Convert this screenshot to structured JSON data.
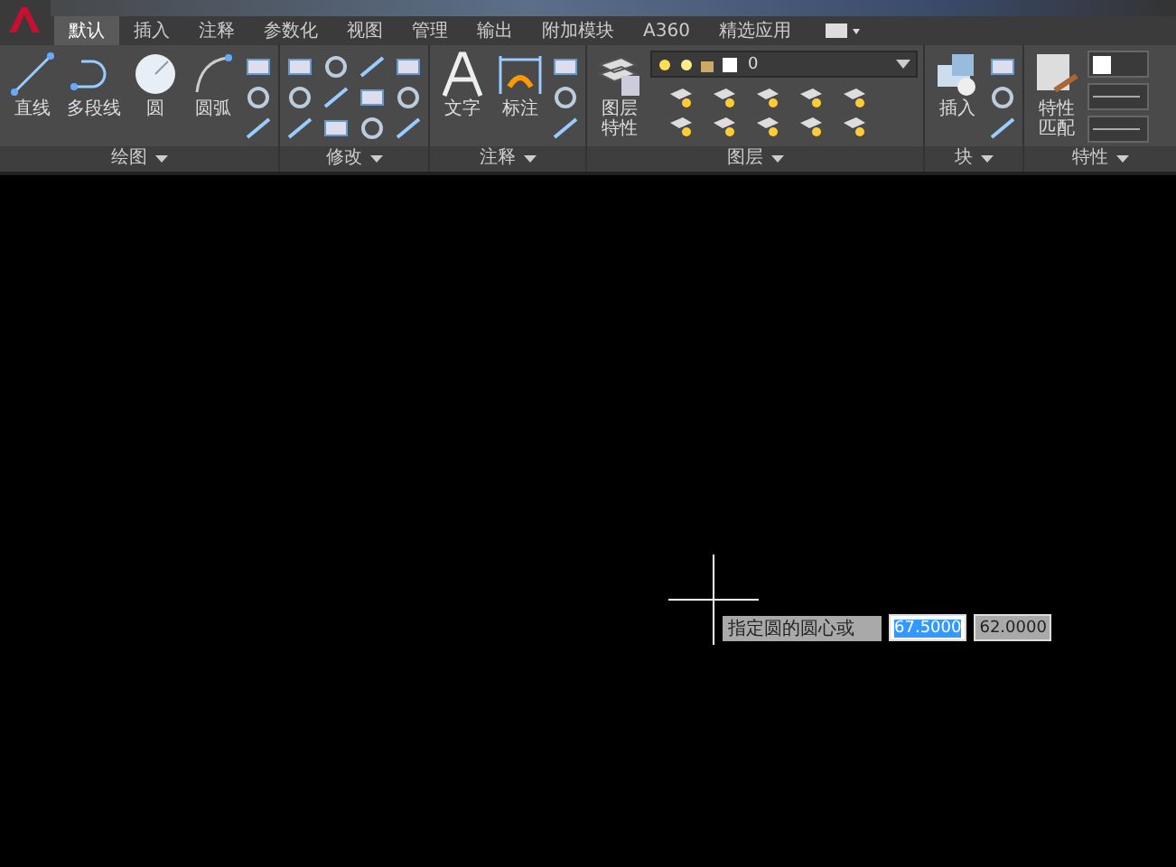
{
  "tabs": [
    {
      "label": "默认",
      "selected": true
    },
    {
      "label": "插入",
      "selected": false
    },
    {
      "label": "注释",
      "selected": false
    },
    {
      "label": "参数化",
      "selected": false
    },
    {
      "label": "视图",
      "selected": false
    },
    {
      "label": "管理",
      "selected": false
    },
    {
      "label": "输出",
      "selected": false
    },
    {
      "label": "附加模块",
      "selected": false
    },
    {
      "label": "A360",
      "selected": false
    },
    {
      "label": "精选应用",
      "selected": false
    }
  ],
  "panels": [
    {
      "title": "绘图",
      "tools": [
        {
          "label": "直线",
          "kind": "line"
        },
        {
          "label": "多段线",
          "kind": "polyline"
        },
        {
          "label": "圆",
          "kind": "circle"
        },
        {
          "label": "圆弧",
          "kind": "arc"
        }
      ]
    },
    {
      "title": "修改"
    },
    {
      "title": "注释",
      "tools": [
        {
          "label": "文字",
          "kind": "text"
        },
        {
          "label": "标注",
          "kind": "dimension"
        }
      ]
    },
    {
      "title": "图层",
      "tools": [
        {
          "label": "图层特性",
          "kind": "layers"
        }
      ],
      "layer_value": "0"
    },
    {
      "title": "块",
      "tools": [
        {
          "label": "插入",
          "kind": "insert"
        }
      ]
    },
    {
      "title": "特性",
      "tools": [
        {
          "label": "特性匹配",
          "kind": "match"
        }
      ]
    }
  ],
  "command_input": {
    "prompt": "指定圆的圆心或",
    "fields": [
      {
        "value": "67.5000",
        "selected": true
      },
      {
        "value": "62.0000",
        "selected": false
      }
    ]
  }
}
